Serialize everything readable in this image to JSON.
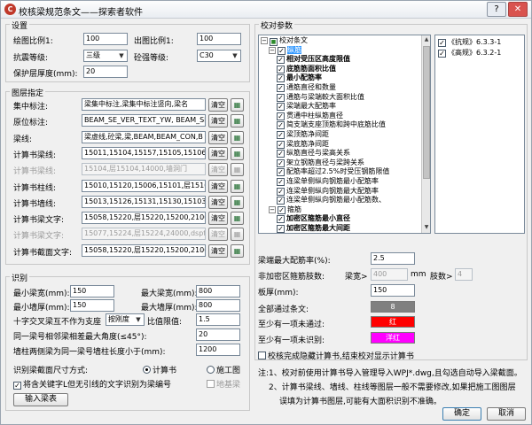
{
  "window": {
    "title": "校核梁规范条文——探索者软件",
    "close_glyph": "✕",
    "help_glyph": "?"
  },
  "settings": {
    "title": "设置",
    "drawing_scale_label": "绘图比例1:",
    "drawing_scale": "100",
    "output_scale_label": "出图比例1:",
    "output_scale": "100",
    "seismic_label": "抗震等级:",
    "seismic": "三级",
    "concrete_label": "砼强等级:",
    "concrete": "C30",
    "cover_label": "保护层厚度(mm):",
    "cover": "20"
  },
  "layers": {
    "title": "图层指定",
    "clear_label": "清空",
    "rows": [
      {
        "label": "集中标注:",
        "value": "梁集中标注,梁集中标注竖向,梁名",
        "disabled": false
      },
      {
        "label": "原位标注:",
        "value": "BEAM_SE_VER_TEXT_YW, BEAM_SE_VE",
        "disabled": false
      },
      {
        "label": "梁线:",
        "value": "梁虚线,砼梁,梁,BEAM,BEAM_CON,B",
        "disabled": false
      },
      {
        "label": "计算书梁线:",
        "value": "15011,15104,15157,15105,15106,",
        "disabled": false
      },
      {
        "label": "计算书梁线:",
        "value": "15104,层15104,14000,墙洞门",
        "disabled": true
      },
      {
        "label": "计算书柱线:",
        "value": "15010,15120,15006,15101,层1510",
        "disabled": false
      },
      {
        "label": "计算书墙线:",
        "value": "15013,15126,15131,15130,15103,",
        "disabled": false
      },
      {
        "label": "计算书梁文字:",
        "value": "15058,15220,层15220,15200,2100",
        "disabled": false
      },
      {
        "label": "计算书梁文字:",
        "value": "15077,15224,层15224,24000,dspt",
        "disabled": true
      },
      {
        "label": "计算书截面文字:",
        "value": "15058,15220,层15220,15200,2100",
        "disabled": false
      }
    ]
  },
  "recognition": {
    "title": "识别",
    "min_beam_width_label": "最小梁宽(mm):",
    "min_beam_width": "150",
    "max_beam_width_label": "最大梁宽(mm):",
    "max_beam_width": "800",
    "min_wall_thick_label": "最小墙厚(mm):",
    "min_wall_thick": "150",
    "max_wall_thick_label": "最大墙厚(mm):",
    "max_wall_thick": "800",
    "cross_support_label": "十字交叉梁互不作为支座",
    "cross_support_select": "按刚度",
    "ratio_label": "比值限值:",
    "ratio": "1.5",
    "max_angle_label": "同一梁号相邻梁相差最大角度(≤45°):",
    "max_angle": "20",
    "wall_gap_label": "墙柱两侧梁为同一梁号墙柱长度小于(mm):",
    "wall_gap": "1200",
    "section_size_label": "识别梁截面尺寸方式:",
    "radio_calc": "计算书",
    "radio_drawing": "施工图",
    "checkbox_keyword": "将含关键字L但无引线的文字识别为梁编号",
    "checkbox_foundation": "地基梁",
    "import_button": "输入梁表"
  },
  "check": {
    "title": "校对参数",
    "tree": [
      {
        "text": "校对条文",
        "level": 0,
        "bold": false,
        "state": "partial",
        "expander": "−"
      },
      {
        "text": "纵筋",
        "level": 1,
        "bold": false,
        "state": "checked",
        "expander": "−",
        "selected": true
      },
      {
        "text": "相对受压区高度限值",
        "level": 2,
        "bold": true,
        "state": "checked"
      },
      {
        "text": "底筋筋面积比值",
        "level": 2,
        "bold": true,
        "state": "checked"
      },
      {
        "text": "最小配筋率",
        "level": 2,
        "bold": true,
        "state": "checked"
      },
      {
        "text": "通筋直径和数量",
        "level": 2,
        "bold": false,
        "state": "checked"
      },
      {
        "text": "通筋与梁端較大面积比值",
        "level": 2,
        "bold": false,
        "state": "checked"
      },
      {
        "text": "梁端最大配筋率",
        "level": 2,
        "bold": false,
        "state": "checked"
      },
      {
        "text": "贯通中柱纵筋直径",
        "level": 2,
        "bold": false,
        "state": "checked"
      },
      {
        "text": "简支端支座顶筋和跨中底筋比值",
        "level": 2,
        "bold": false,
        "state": "checked"
      },
      {
        "text": "梁顶筋净间距",
        "level": 2,
        "bold": false,
        "state": "checked"
      },
      {
        "text": "梁底筋净间距",
        "level": 2,
        "bold": false,
        "state": "checked"
      },
      {
        "text": "纵筋直径与梁高关系",
        "level": 2,
        "bold": false,
        "state": "checked"
      },
      {
        "text": "架立钢筋直径与梁跨关系",
        "level": 2,
        "bold": false,
        "state": "checked"
      },
      {
        "text": "配筋率超过2.5%时受压钢筋限值",
        "level": 2,
        "bold": false,
        "state": "checked"
      },
      {
        "text": "连梁单侧纵向钢筋最小配筋率",
        "level": 2,
        "bold": false,
        "state": "checked"
      },
      {
        "text": "连梁单侧纵向钢筋最大配筋率",
        "level": 2,
        "bold": false,
        "state": "checked"
      },
      {
        "text": "连梁单侧纵向钢筋最小配筋数、",
        "level": 2,
        "bold": false,
        "state": "checked"
      },
      {
        "text": "箍筋",
        "level": 1,
        "bold": false,
        "state": "checked",
        "expander": "−"
      },
      {
        "text": "加密区箍筋最小直径",
        "level": 2,
        "bold": true,
        "state": "checked"
      },
      {
        "text": "加密区箍筋最大间距",
        "level": 2,
        "bold": true,
        "state": "checked"
      }
    ],
    "spec_list": [
      "《抗规》6.3.3-1",
      "《高规》6.3.2-1"
    ],
    "max_rebar_ratio_label": "梁端最大配筋率(%):",
    "max_rebar_ratio": "2.5",
    "stirrup_limbs_label": "非加密区箍筋肢数:",
    "beam_width_label": "梁宽>",
    "beam_width": "400",
    "mm_label": "mm",
    "limbs_label": "肢数>",
    "limbs": "4",
    "slab_thick_label": "板厚(mm):",
    "slab_thick": "150",
    "all_pass_label": "全部通过条文:",
    "all_pass_value": "8",
    "one_fail_label": "至少有一项未通过:",
    "one_fail_value": "红",
    "one_unknown_label": "至少有一项未识别:",
    "one_unknown_value": "洋红",
    "after_check_label": "校核完成隐藏计算书,结束校对显示计算书",
    "colors": {
      "gray": "#808080",
      "red": "#ff0000",
      "magenta": "#ff00ff"
    }
  },
  "notes": {
    "line1": "注:1、校对前使用计算书导入管理导入WPJ*.dwg,且勾选自动导入梁截面。",
    "line2": "2、计算书梁线、墙线、柱线等图层一般不需要修改,如果把施工图图层",
    "line3": "误填为计算书图层,可能有大面积识别不准确。"
  },
  "footer": {
    "ok": "确定",
    "cancel": "取消"
  }
}
